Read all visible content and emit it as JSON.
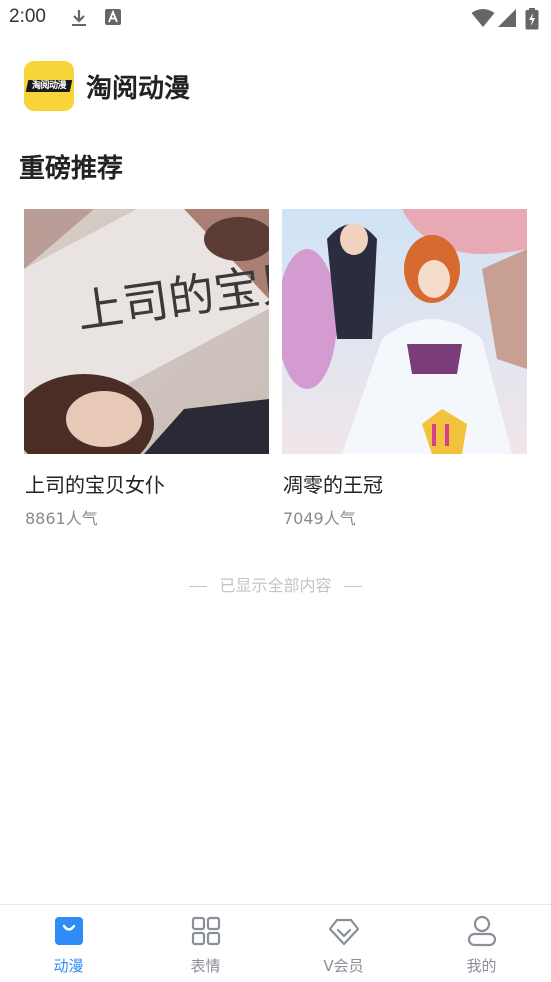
{
  "status_bar": {
    "time": "2:00",
    "icons": [
      "download-icon",
      "text-a-icon",
      "wifi-icon",
      "signal-icon",
      "battery-charging-icon"
    ]
  },
  "header": {
    "logo_text": "淘阅动漫",
    "app_name": "淘阅动漫"
  },
  "section": {
    "title": "重磅推荐"
  },
  "cards": [
    {
      "title": "上司的宝贝女仆",
      "popularity": "8861人气",
      "cover_text": "上司的宝贝女仆"
    },
    {
      "title": "凋零的王冠",
      "popularity": "7049人气"
    }
  ],
  "end_note": "已显示全部内容",
  "tabbar": {
    "accent_color": "#2f8bf5",
    "inactive_color": "#8a8f99",
    "tabs": [
      {
        "label": "动漫",
        "icon": "shopping-bag-icon",
        "active": true
      },
      {
        "label": "表情",
        "icon": "grid-icon",
        "active": false
      },
      {
        "label": "V会员",
        "icon": "diamond-icon",
        "active": false
      },
      {
        "label": "我的",
        "icon": "user-icon",
        "active": false
      }
    ]
  }
}
